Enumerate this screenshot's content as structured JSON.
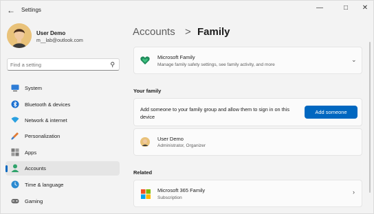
{
  "window": {
    "title": "Settings",
    "back_icon": "arrow-left-icon",
    "controls": [
      "minimize-icon",
      "maximize-icon",
      "close-icon"
    ]
  },
  "user": {
    "name": "User Demo",
    "email": "m__lab@outlook.com"
  },
  "search": {
    "placeholder": "Find a setting"
  },
  "sidebar": {
    "items": [
      {
        "label": "System",
        "icon": "monitor-icon",
        "active": false
      },
      {
        "label": "Bluetooth & devices",
        "icon": "bluetooth-icon",
        "active": false
      },
      {
        "label": "Network & internet",
        "icon": "wifi-icon",
        "active": false
      },
      {
        "label": "Personalization",
        "icon": "paintbrush-icon",
        "active": false
      },
      {
        "label": "Apps",
        "icon": "apps-icon",
        "active": false
      },
      {
        "label": "Accounts",
        "icon": "person-icon",
        "active": true
      },
      {
        "label": "Time & language",
        "icon": "globe-clock-icon",
        "active": false
      },
      {
        "label": "Gaming",
        "icon": "gamepad-icon",
        "active": false
      }
    ]
  },
  "breadcrumb": {
    "parent": "Accounts",
    "separator": ">",
    "current": "Family"
  },
  "family_app": {
    "title": "Microsoft Family",
    "subtitle": "Manage family safety settings, see family activity, and more"
  },
  "your_family": {
    "heading": "Your family",
    "add_text": "Add someone to your family group and allow them to sign in on this device",
    "add_button": "Add someone",
    "member": {
      "name": "User Demo",
      "role": "Administrator, Organizer"
    }
  },
  "related": {
    "heading": "Related",
    "item": {
      "title": "Microsoft 365 Family",
      "subtitle": "Subscription"
    }
  },
  "colors": {
    "accent": "#0067c0",
    "background": "#f3f3f3",
    "card": "#fbfbfb"
  }
}
